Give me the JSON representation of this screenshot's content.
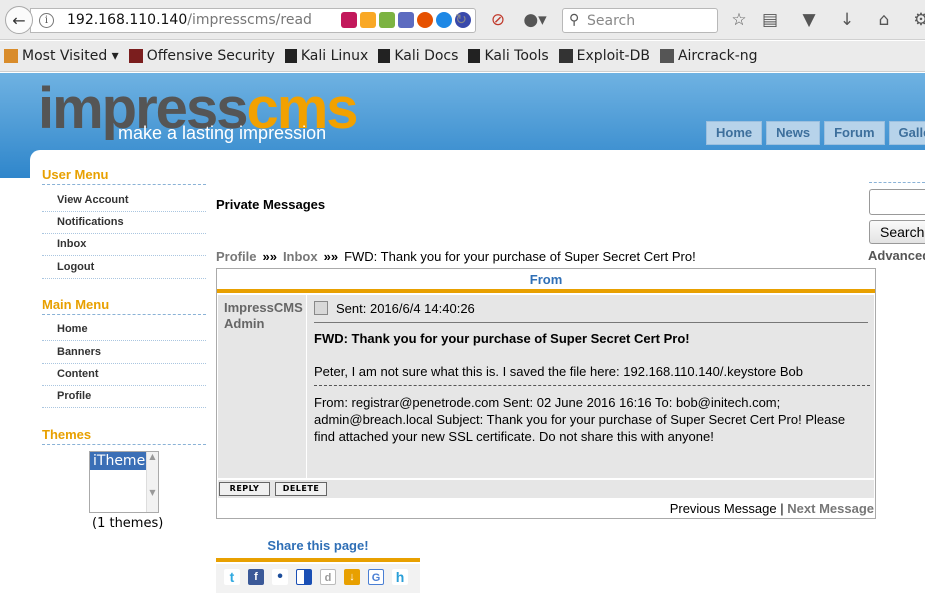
{
  "browser": {
    "url_host": "192.168.110.140",
    "url_path": "/impresscms/read",
    "search_placeholder": "Search",
    "icons": [
      "back-icon",
      "info-icon",
      "reload-icon",
      "block-icon",
      "addon-icon",
      "search-icon",
      "star-icon",
      "reading-list-icon",
      "pocket-icon",
      "download-icon",
      "home-icon",
      "more-icon"
    ],
    "extension_colors": [
      "#c2185b",
      "#f9a825",
      "#7cb342",
      "#5c6bc0",
      "#e65100",
      "#1e88e5",
      "#3949ab"
    ]
  },
  "bookmarks": [
    {
      "label": "Most Visited ▾",
      "icon": "folder-icon",
      "color": "#d98c2b"
    },
    {
      "label": "Offensive Security",
      "icon": "offsec-icon",
      "color": "#7b1e1e"
    },
    {
      "label": "Kali Linux",
      "icon": "kali-icon",
      "color": "#222222"
    },
    {
      "label": "Kali Docs",
      "icon": "kali-icon",
      "color": "#222222"
    },
    {
      "label": "Kali Tools",
      "icon": "kali-icon",
      "color": "#222222"
    },
    {
      "label": "Exploit-DB",
      "icon": "exploitdb-icon",
      "color": "#333333"
    },
    {
      "label": "Aircrack-ng",
      "icon": "aircrack-icon",
      "color": "#555555"
    }
  ],
  "header": {
    "logo_impress": "impress",
    "logo_cms": "cms",
    "tagline": "make a lasting impression",
    "nav": [
      "Home",
      "News",
      "Forum",
      "Galle"
    ]
  },
  "sidebar": {
    "user_menu_title": "User Menu",
    "user_menu": [
      "View Account",
      "Notifications",
      "Inbox",
      "Logout"
    ],
    "main_menu_title": "Main Menu",
    "main_menu": [
      "Home",
      "Banners",
      "Content",
      "Profile"
    ],
    "themes_title": "Themes",
    "theme_selected": "iTheme",
    "theme_count": "(1 themes)"
  },
  "main": {
    "title": "Private Messages",
    "breadcrumb": {
      "profile": "Profile",
      "sep": "»»",
      "inbox": "Inbox",
      "current": "FWD: Thank you for your purchase of Super Secret Cert Pro!"
    },
    "table_header": "From",
    "sender_line1": "ImpressCMS",
    "sender_line2": "Admin",
    "sent": "Sent: 2016/6/4 14:40:26",
    "subject": "FWD: Thank you for your purchase of Super Secret Cert Pro!",
    "body": "Peter, I am not sure what this is. I saved the file here: 192.168.110.140/.keystore Bob",
    "forwarded": "From: registrar@penetrode.com Sent: 02 June 2016 16:16 To: bob@initech.com; admin@breach.local Subject: Thank you for your purchase of Super Secret Cert Pro! Please find attached your new SSL certificate. Do not share this with anyone!",
    "reply_label": "REPLY",
    "delete_label": "DELETE",
    "prev_label": "Previous Message",
    "pager_sep": "|",
    "next_label": "Next Message"
  },
  "share": {
    "title": "Share this page!",
    "icons": [
      {
        "name": "twitter-icon",
        "glyph": "t",
        "color": "#2fa9e0"
      },
      {
        "name": "facebook-icon",
        "glyph": "f",
        "color": "#3b5998"
      },
      {
        "name": "myspace-icon",
        "glyph": "•",
        "color": "#1d4e9b"
      },
      {
        "name": "delicious-icon",
        "glyph": "",
        "color": "#1a4fb5"
      },
      {
        "name": "digg-icon",
        "glyph": "d",
        "color": "#9a9a9a"
      },
      {
        "name": "download-icon",
        "glyph": "↓",
        "color": "#e8a000"
      },
      {
        "name": "google-icon",
        "glyph": "G",
        "color": "#4a7fd4"
      },
      {
        "name": "hi5-icon",
        "glyph": "h",
        "color": "#2a9fd8"
      }
    ]
  },
  "right": {
    "search_button": "Search",
    "advanced": "Advanced"
  }
}
